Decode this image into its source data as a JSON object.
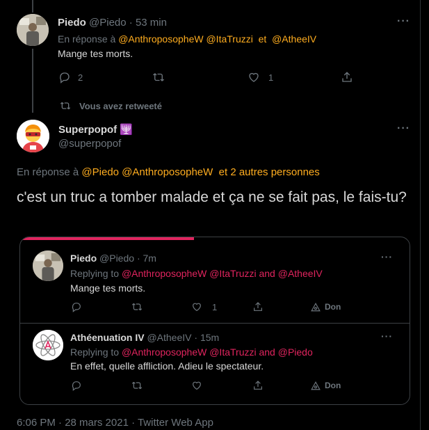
{
  "reply1": {
    "name": "Piedo",
    "handle": "@Piedo",
    "sep": "·",
    "time": "53 min",
    "in_reply_prefix": "En réponse à",
    "mentions": [
      "@AnthroposopheW",
      "@ItaTruzzi",
      "et",
      "@AtheeIV"
    ],
    "text": "Mange tes morts.",
    "reply_count": "2",
    "like_count": "1"
  },
  "retweet_notice": {
    "label": "Vous avez retweeté"
  },
  "main_tweet": {
    "name": "Superpopof",
    "badge": "🕎",
    "handle": "@superpopof",
    "in_reply_prefix": "En réponse à",
    "mentions": [
      "@Piedo",
      "@AnthroposopheW",
      "et 2 autres personnes"
    ],
    "text": "c'est un truc a tomber malade et ça ne se fait pas, le fais-tu?",
    "timestamp": "6:06 PM · 28 mars 2021 · Twitter Web App"
  },
  "quote1": {
    "name": "Piedo",
    "handle": "@Piedo",
    "sep": "·",
    "time": "7m",
    "in_reply_prefix": "Replying to",
    "mentions": [
      "@AnthroposopheW",
      "@ItaTruzzi",
      "and",
      "@AtheeIV"
    ],
    "text": "Mange tes morts.",
    "like_count": "1",
    "don_label": "Don"
  },
  "quote2": {
    "name": "Athéenuation IV",
    "handle": "@AtheeIV",
    "sep": "·",
    "time": "15m",
    "in_reply_prefix": "Replying to",
    "mentions": [
      "@AnthroposopheW",
      "@ItaTruzzi",
      "and",
      "@Piedo"
    ],
    "text": "En effet, quelle affliction. Adieu le spectateur.",
    "don_label": "Don"
  },
  "icons": [
    "reply-icon",
    "retweet-icon",
    "like-icon",
    "share-icon",
    "more-icon",
    "don-icon"
  ],
  "colors": {
    "background": "#000000",
    "mention": "#ffad1f",
    "mention_quote": "#e0245e",
    "muted": "#6e767d"
  }
}
